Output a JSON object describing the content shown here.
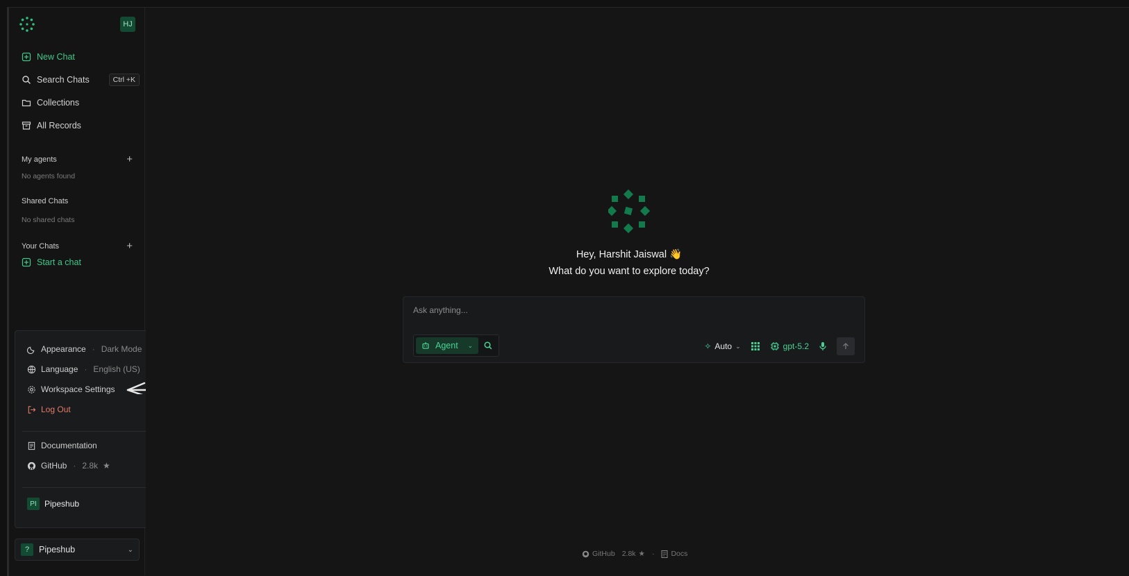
{
  "sidebar": {
    "avatar_initials": "HJ",
    "nav": {
      "new_chat": "New Chat",
      "search_chats": "Search Chats",
      "search_shortcut": "Ctrl +K",
      "collections": "Collections",
      "all_records": "All Records"
    },
    "my_agents": {
      "label": "My agents",
      "empty": "No agents found"
    },
    "shared_chats": {
      "label": "Shared Chats",
      "empty": "No shared chats"
    },
    "your_chats": {
      "label": "Your Chats",
      "start": "Start a chat"
    },
    "workspace": {
      "badge": "?",
      "name": "Pipeshub"
    }
  },
  "menu": {
    "appearance": {
      "label": "Appearance",
      "value": "Dark Mode"
    },
    "language": {
      "label": "Language",
      "value": "English (US)"
    },
    "workspace_settings": "Workspace Settings",
    "logout": "Log Out",
    "documentation": "Documentation",
    "github": {
      "label": "GitHub",
      "stars": "2.8k"
    },
    "org": {
      "badge": "PI",
      "name": "Pipeshub"
    }
  },
  "main": {
    "greeting": "Hey, Harshit Jaiswal 👋",
    "subgreeting": "What do you want to explore today?",
    "composer": {
      "placeholder": "Ask anything...",
      "mode": "Agent",
      "auto": "Auto",
      "model": "gpt-5.2"
    },
    "footer": {
      "github": "GitHub",
      "stars": "2.8k",
      "docs": "Docs"
    }
  },
  "colors": {
    "accent": "#3fc78a",
    "logout": "#e07a6a"
  }
}
